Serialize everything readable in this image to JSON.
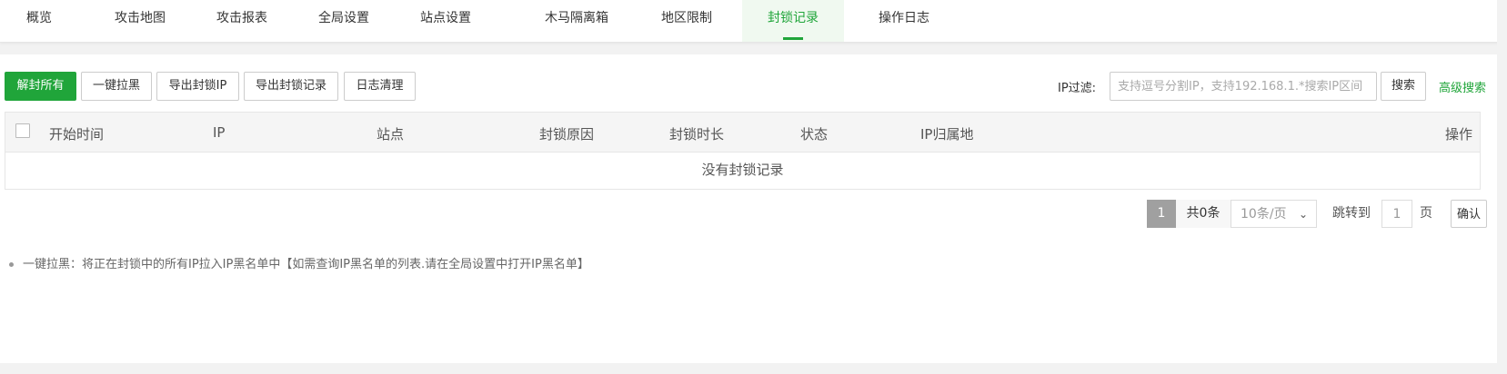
{
  "tabs": [
    {
      "label": "概览",
      "active": false
    },
    {
      "label": "攻击地图",
      "active": false
    },
    {
      "label": "攻击报表",
      "active": false
    },
    {
      "label": "全局设置",
      "active": false
    },
    {
      "label": "站点设置",
      "active": false
    },
    {
      "label": "木马隔离箱",
      "active": false
    },
    {
      "label": "地区限制",
      "active": false
    },
    {
      "label": "封锁记录",
      "active": true
    },
    {
      "label": "操作日志",
      "active": false
    }
  ],
  "toolbar": {
    "unblock_all": "解封所有",
    "one_click_blacklist": "一键拉黑",
    "export_blocked_ip": "导出封锁IP",
    "export_block_records": "导出封锁记录",
    "clear_logs": "日志清理",
    "ip_filter_label": "IP过滤:",
    "ip_filter_placeholder": "支持逗号分割IP，支持192.168.1.*搜索IP区间",
    "search": "搜索",
    "advanced_search": "高级搜索"
  },
  "table": {
    "columns": [
      "开始时间",
      "IP",
      "站点",
      "封锁原因",
      "封锁时长",
      "状态",
      "IP归属地",
      "操作"
    ],
    "rows": [],
    "empty_text": "没有封锁记录"
  },
  "pagination": {
    "current_page": "1",
    "total": "共0条",
    "page_size": "10条/页",
    "jump_label": "跳转到",
    "jump_value": "1",
    "page_unit": "页",
    "confirm": "确认"
  },
  "note": "一键拉黑：将正在封锁中的所有IP拉入IP黑名单中【如需查询IP黑名单的列表.请在全局设置中打开IP黑名单】",
  "colors": {
    "accent": "#20a53a",
    "current_page_bg": "#a0a0a0",
    "header_bg": "#f5f5f5"
  }
}
